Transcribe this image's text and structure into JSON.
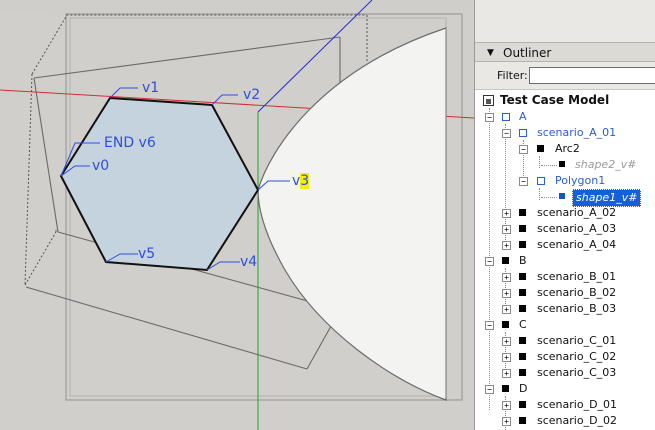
{
  "viewport": {
    "vertex_labels": [
      {
        "id": "v0",
        "text": "v0"
      },
      {
        "id": "v1",
        "text": "v1"
      },
      {
        "id": "v2",
        "text": "v2"
      },
      {
        "id": "v3_prefix",
        "text": "v"
      },
      {
        "id": "v3_digit",
        "text": "3"
      },
      {
        "id": "v4",
        "text": "v4"
      },
      {
        "id": "v5",
        "text": "v5"
      },
      {
        "id": "end_v6",
        "text": "END v6"
      }
    ],
    "colors": {
      "polygon_fill": "#c5d3df",
      "highlight": "#f3f000",
      "label_blue": "#2f4fd8",
      "axis_red": "#d23030",
      "axis_green": "#2aa02a",
      "axis_blue": "#2a2ad8"
    }
  },
  "outliner": {
    "title": "Outliner",
    "collapse_glyph": "▼",
    "filter_label": "Filter:",
    "filter_value": "",
    "root_label": "Test Case Model",
    "nodes": [
      {
        "label": "A"
      },
      {
        "label": "scenario_A_01"
      },
      {
        "label": "Arc2"
      },
      {
        "label": "shape2_v#"
      },
      {
        "label": "Polygon1"
      },
      {
        "label": "shape1_v#"
      },
      {
        "label": "scenario_A_02"
      },
      {
        "label": "scenario_A_03"
      },
      {
        "label": "scenario_A_04"
      },
      {
        "label": "B"
      },
      {
        "label": "scenario_B_01"
      },
      {
        "label": "scenario_B_02"
      },
      {
        "label": "scenario_B_03"
      },
      {
        "label": "C"
      },
      {
        "label": "scenario_C_01"
      },
      {
        "label": "scenario_C_02"
      },
      {
        "label": "scenario_C_03"
      },
      {
        "label": "D"
      },
      {
        "label": "scenario_D_01"
      },
      {
        "label": "scenario_D_02"
      }
    ],
    "toggle_collapse": "−",
    "toggle_expand": "+"
  }
}
